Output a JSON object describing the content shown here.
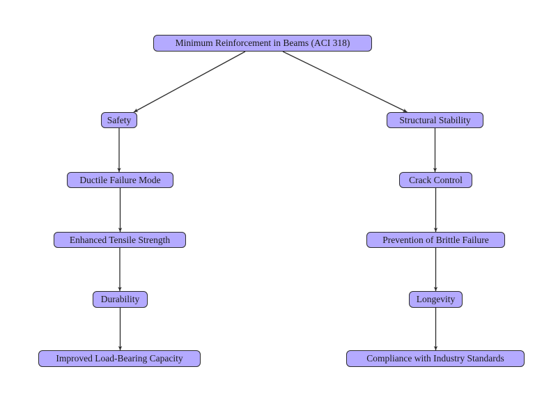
{
  "diagram": {
    "type": "tree",
    "node_fill": "#b4aaff",
    "node_stroke": "#2b2b2b",
    "edge_color": "#2b2b2b",
    "root": {
      "id": "root",
      "label": "Minimum Reinforcement in Beams (ACI 318)"
    },
    "branches": [
      {
        "name": "left",
        "nodes": [
          {
            "id": "safety",
            "label": "Safety"
          },
          {
            "id": "ductile",
            "label": "Ductile Failure Mode"
          },
          {
            "id": "tensile",
            "label": "Enhanced Tensile Strength"
          },
          {
            "id": "durability",
            "label": "Durability"
          },
          {
            "id": "loadbearing",
            "label": "Improved Load-Bearing Capacity"
          }
        ]
      },
      {
        "name": "right",
        "nodes": [
          {
            "id": "stability",
            "label": "Structural Stability"
          },
          {
            "id": "crack",
            "label": "Crack Control"
          },
          {
            "id": "brittle",
            "label": "Prevention of Brittle Failure"
          },
          {
            "id": "longevity",
            "label": "Longevity"
          },
          {
            "id": "compliance",
            "label": "Compliance with Industry Standards"
          }
        ]
      }
    ],
    "edges": [
      [
        "root",
        "safety"
      ],
      [
        "root",
        "stability"
      ],
      [
        "safety",
        "ductile"
      ],
      [
        "ductile",
        "tensile"
      ],
      [
        "tensile",
        "durability"
      ],
      [
        "durability",
        "loadbearing"
      ],
      [
        "stability",
        "crack"
      ],
      [
        "crack",
        "brittle"
      ],
      [
        "brittle",
        "longevity"
      ],
      [
        "longevity",
        "compliance"
      ]
    ]
  }
}
